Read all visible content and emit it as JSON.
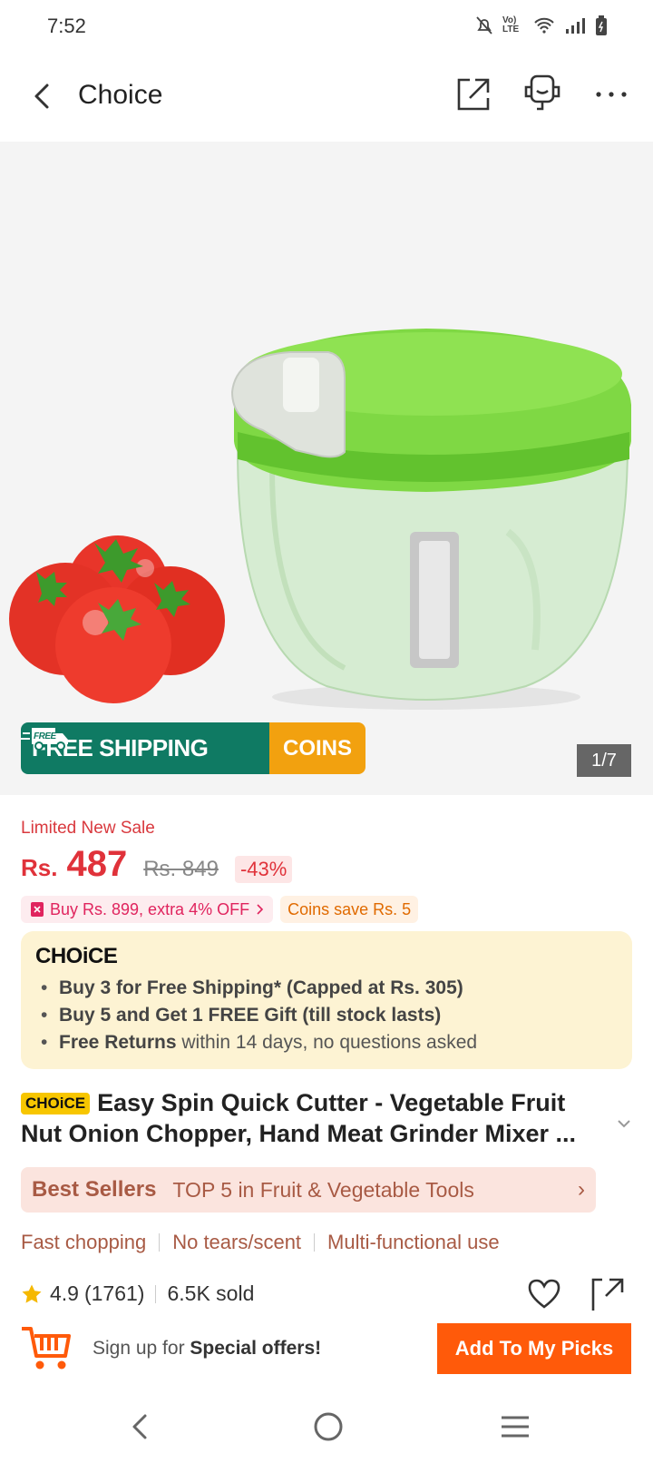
{
  "status_bar": {
    "time": "7:52",
    "volte_label": "Vo) LTE"
  },
  "header": {
    "title": "Choice"
  },
  "gallery": {
    "counter": "1/7",
    "promo_free_badge": "FREE",
    "promo_shipping": "FREE SHIPPING",
    "promo_coins": "COINS"
  },
  "pricing": {
    "sale_label": "Limited New Sale",
    "currency": "Rs.",
    "price": "487",
    "original_price": "Rs. 849",
    "discount": "-43%",
    "bundle_offer": "Buy Rs. 899, extra 4% OFF",
    "coins_offer": "Coins save Rs. 5"
  },
  "choice_box": {
    "logo": "CHOiCE",
    "items": [
      {
        "bold": "Buy 3 for  Free Shipping* (Capped at Rs. 305)",
        "rest": ""
      },
      {
        "bold": "Buy 5 and Get 1 FREE Gift (till stock lasts)",
        "rest": ""
      },
      {
        "bold": "Free Returns",
        "rest": " within 14 days, no questions asked"
      }
    ]
  },
  "product": {
    "tag": "CHOiCE",
    "title": "Easy Spin Quick Cutter - Vegetable Fruit Nut Onion Chopper, Hand Meat Grinder Mixer ..."
  },
  "best_sellers": {
    "title": "Best Sellers",
    "text": "TOP 5 in Fruit & Vegetable Tools",
    "chevron": "›"
  },
  "features": [
    "Fast chopping",
    "No tears/scent",
    "Multi-functional use"
  ],
  "rating": {
    "score": "4.9",
    "count": "(1761)",
    "sold": "6.5K sold"
  },
  "signup": {
    "prefix": "Sign up for ",
    "highlight": "Special offers!",
    "button": "Add To My Picks"
  },
  "colors": {
    "accent": "#ff5a0a",
    "price_red": "#e0323a",
    "shipping_green": "#0f7a63",
    "coins_orange": "#f2a10f",
    "choice_bg": "#fdf3d3"
  }
}
